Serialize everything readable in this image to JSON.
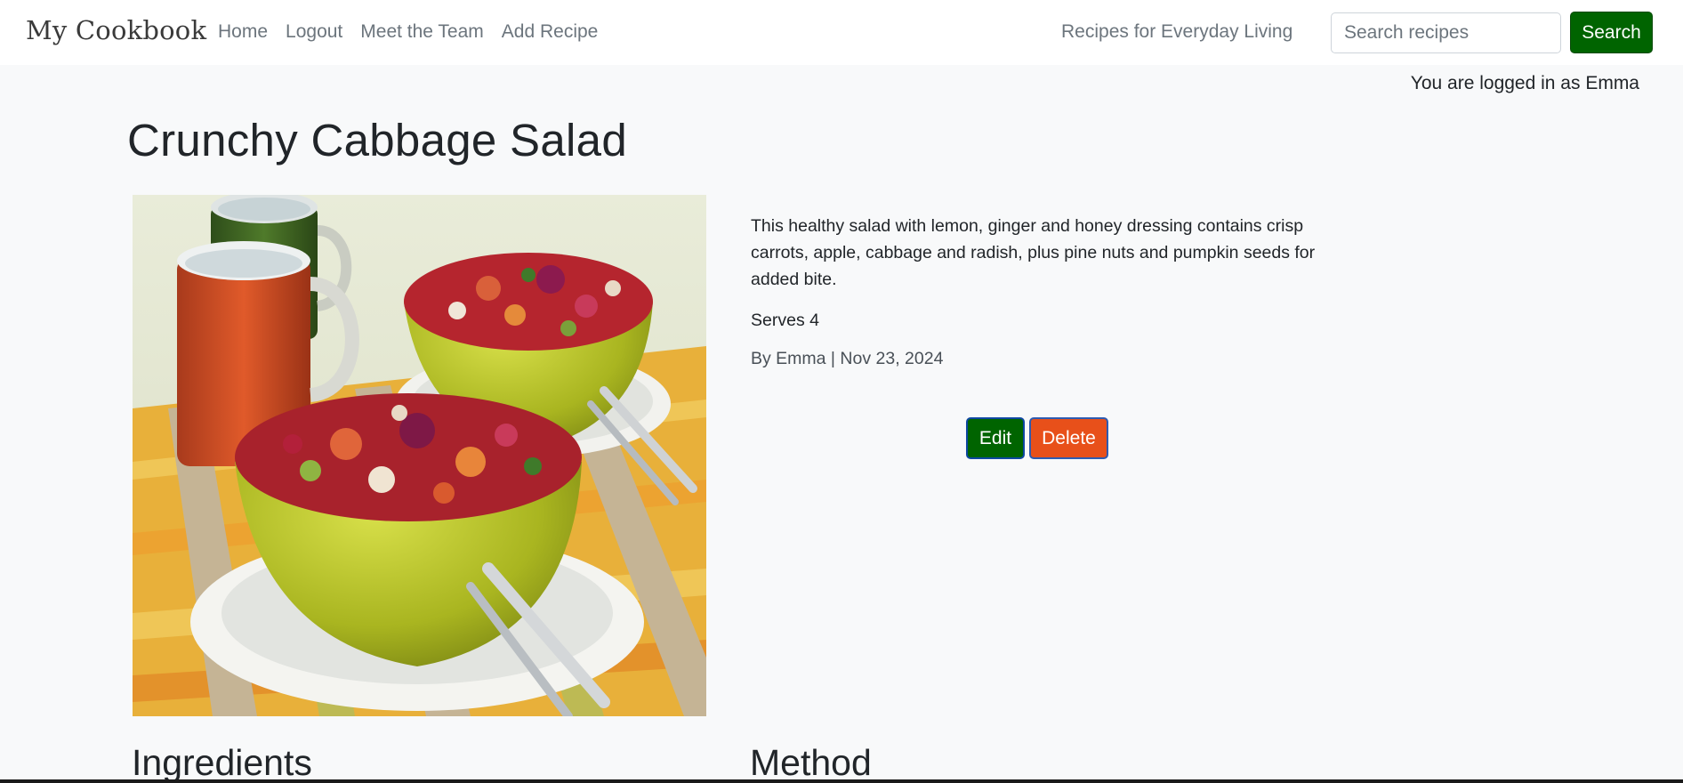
{
  "navbar": {
    "brand": "My Cookbook",
    "links": [
      "Home",
      "Logout",
      "Meet the Team",
      "Add Recipe"
    ],
    "tagline": "Recipes for Everyday Living",
    "search_placeholder": "Search recipes",
    "search_button": "Search"
  },
  "session": {
    "logged_in_text": "You are logged in as Emma"
  },
  "recipe": {
    "title": "Crunchy Cabbage Salad",
    "description": "This healthy salad with lemon, ginger and honey dressing contains crisp carrots, apple, cabbage and radish, plus pine nuts and pumpkin seeds for added bite.",
    "serves": "Serves 4",
    "byline": "By Emma | Nov 23, 2024",
    "edit_label": "Edit",
    "delete_label": "Delete",
    "ingredients_heading": "Ingredients",
    "method_heading": "Method"
  },
  "colors": {
    "primary_green": "#006400",
    "delete_orange": "#e8501a",
    "page_background": "#f8f9fa"
  },
  "icons": {
    "recipe_photo": "salad-bowls-photo"
  }
}
